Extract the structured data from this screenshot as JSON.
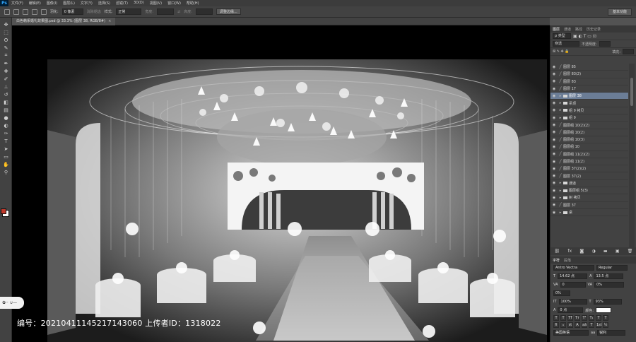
{
  "app": {
    "logo": "Ps",
    "menu": [
      "文件(F)",
      "编辑(E)",
      "图像(I)",
      "图层(L)",
      "文字(Y)",
      "选择(S)",
      "滤镜(T)",
      "3D(D)",
      "视图(V)",
      "窗口(W)",
      "帮助(H)"
    ]
  },
  "options": {
    "feather_label": "羽化:",
    "feather_value": "0 像素",
    "antialias_label": "消除锯齿",
    "style_label": "样式:",
    "style_value": "正常",
    "width_label": "宽度:",
    "height_label": "高度:",
    "refine_button": "调整边缘...",
    "workspace_button": "基本功能"
  },
  "document": {
    "tab_title": "白色韩系婚礼效果图.psd @ 33.3% (图层 38, RGB/8#)"
  },
  "tools": [
    "move-icon",
    "marquee-icon",
    "lasso-icon",
    "quick-select-icon",
    "crop-icon",
    "eyedropper-icon",
    "healing-icon",
    "brush-icon",
    "stamp-icon",
    "history-brush-icon",
    "eraser-icon",
    "gradient-icon",
    "blur-icon",
    "dodge-icon",
    "pen-icon",
    "type-icon",
    "path-select-icon",
    "shape-icon",
    "hand-icon",
    "zoom-icon"
  ],
  "tool_glyphs": [
    "✥",
    "⬚",
    "ʘ",
    "✎",
    "⌗",
    "✒",
    "✚",
    "✐",
    "⊥",
    "↺",
    "◧",
    "▤",
    "●",
    "◐",
    "✑",
    "T",
    "➤",
    "▭",
    "✋",
    "⚲"
  ],
  "panels": {
    "tabs": [
      "图层",
      "通道",
      "路径",
      "历史记录"
    ],
    "filter_label": "ρ 类型",
    "blend_mode": "穿透",
    "opacity_label": "不透明度:",
    "fill_label": "填充:",
    "layers": [
      {
        "name": "图层 85",
        "kind": "layer",
        "selected": false
      },
      {
        "name": "图层 83(2)",
        "kind": "layer",
        "selected": false
      },
      {
        "name": "图层 83",
        "kind": "layer",
        "selected": false
      },
      {
        "name": "图层 17",
        "kind": "layer",
        "selected": false
      },
      {
        "name": "图层 38",
        "kind": "folder",
        "selected": true
      },
      {
        "name": "吊顶",
        "kind": "folder",
        "selected": false
      },
      {
        "name": "组 9 拷贝",
        "kind": "folder",
        "selected": false
      },
      {
        "name": "组 9",
        "kind": "folder",
        "selected": false
      },
      {
        "name": "图层组 10(2)(2)",
        "kind": "layer",
        "selected": false
      },
      {
        "name": "图层组 10(2)",
        "kind": "layer",
        "selected": false
      },
      {
        "name": "图层组 10(3)",
        "kind": "layer",
        "selected": false
      },
      {
        "name": "图层组 10",
        "kind": "layer",
        "selected": false
      },
      {
        "name": "图层组 11(2)(2)",
        "kind": "layer",
        "selected": false
      },
      {
        "name": "图层组 11(2)",
        "kind": "layer",
        "selected": false
      },
      {
        "name": "图层 37(2)(2)",
        "kind": "layer",
        "selected": false
      },
      {
        "name": "图层 37(2)",
        "kind": "layer",
        "selected": false
      },
      {
        "name": "通道",
        "kind": "folder",
        "selected": false
      },
      {
        "name": "图层组 5(3)",
        "kind": "folder",
        "selected": false
      },
      {
        "name": "树 拷贝",
        "kind": "folder",
        "selected": false
      },
      {
        "name": "图层 37",
        "kind": "layer",
        "selected": false
      },
      {
        "name": "桌",
        "kind": "folder",
        "selected": false
      }
    ],
    "character": {
      "tabs": [
        "字符",
        "段落"
      ],
      "font": "Antro Vectra",
      "style": "Regular",
      "size": "14.62 点",
      "leading": "13.5 点",
      "kerning": "0",
      "tracking": "0%",
      "vscale": "100%",
      "hscale": "93%",
      "baseline": "0 点",
      "color_label": "颜色:",
      "language": "美国英语",
      "aa": "锐利",
      "aa_prefix": "aa"
    }
  },
  "overlay": {
    "watermark": "编号：20210411145217143060 上传者ID：1318022",
    "stamp": "✿·· ∪—"
  }
}
